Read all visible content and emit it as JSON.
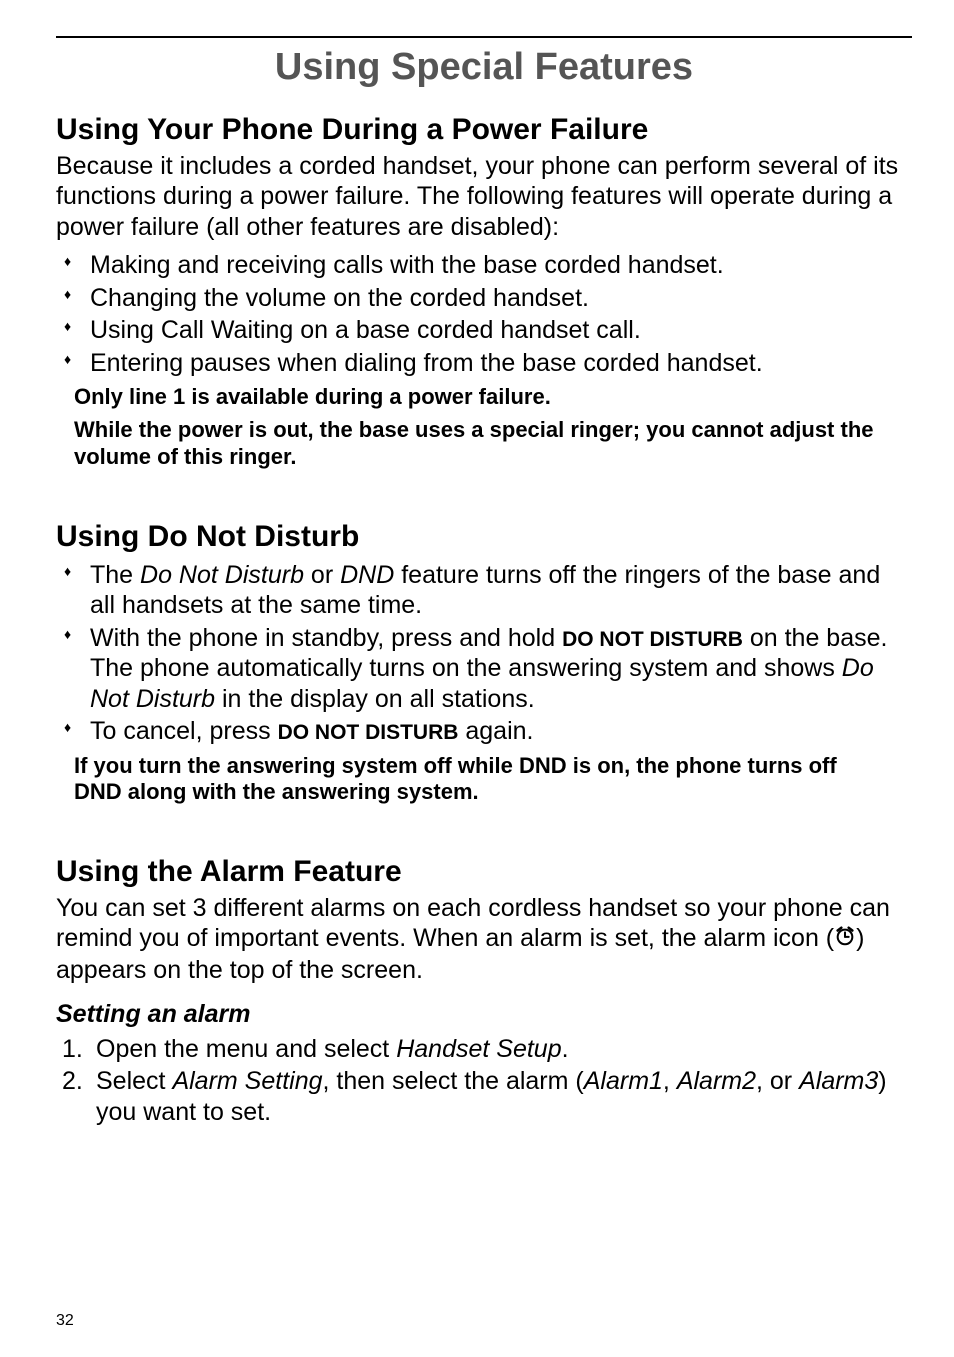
{
  "title": "Using Special Features",
  "section1": {
    "heading": "Using Your Phone During a Power Failure",
    "intro": "Because it includes a corded handset, your phone can perform several of its functions during a power failure. The following features will operate during a power failure (all other features are disabled):",
    "bullets": [
      "Making and receiving calls with the base corded handset.",
      "Changing the volume on the corded handset.",
      "Using Call Waiting on a base corded handset call.",
      "Entering pauses when dialing from the base corded handset."
    ],
    "notes": [
      "Only line 1 is available during a power failure.",
      "While the power is out, the base uses a special ringer; you cannot adjust the volume of this ringer."
    ]
  },
  "section2": {
    "heading": "Using Do Not Disturb",
    "bullets_html": [
      "The <span class=\"italic\">Do Not Disturb</span> or <span class=\"italic\">DND</span> feature turns off the ringers of the base and all handsets at the same time.",
      "With the phone in standby, press and hold <span class=\"small-caps\">DO NOT DISTURB</span> on the base. The phone automatically turns on the answering system and shows <span class=\"italic\">Do Not Disturb</span> in the display on all stations.",
      "To cancel, press <span class=\"small-caps\">DO NOT DISTURB</span> again."
    ],
    "note": "If you turn the answering system off while DND is on, the phone turns off DND along with the answering system."
  },
  "section3": {
    "heading": "Using the Alarm Feature",
    "intro_before": "You can set 3 different alarms on each cordless handset so your phone can remind you of important events. When an alarm is set, the alarm icon (",
    "intro_after": ") appears on the top of the screen.",
    "sub_heading": "Setting an alarm",
    "steps_html": [
      "Open the menu and select <span class=\"italic\">Handset Setup</span>.",
      "Select <span class=\"italic\">Alarm Setting</span>, then select the alarm (<span class=\"italic\">Alarm1</span>, <span class=\"italic\">Alarm2</span>, or <span class=\"italic\">Alarm3</span>) you want to set."
    ]
  },
  "page_number": "32"
}
